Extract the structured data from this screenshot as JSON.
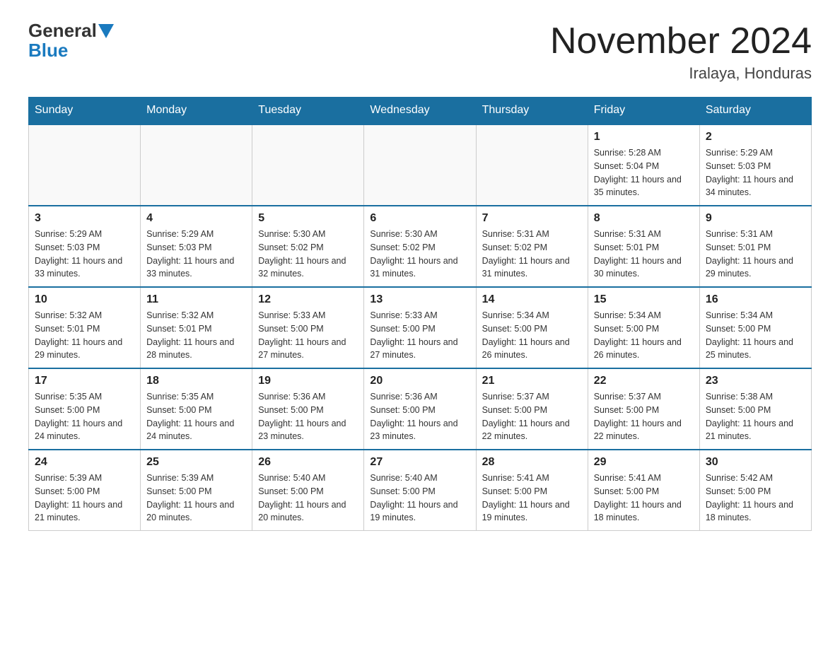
{
  "header": {
    "logo_general": "General",
    "logo_blue": "Blue",
    "month_title": "November 2024",
    "location": "Iralaya, Honduras"
  },
  "days_of_week": [
    "Sunday",
    "Monday",
    "Tuesday",
    "Wednesday",
    "Thursday",
    "Friday",
    "Saturday"
  ],
  "weeks": [
    [
      {
        "day": "",
        "info": ""
      },
      {
        "day": "",
        "info": ""
      },
      {
        "day": "",
        "info": ""
      },
      {
        "day": "",
        "info": ""
      },
      {
        "day": "",
        "info": ""
      },
      {
        "day": "1",
        "info": "Sunrise: 5:28 AM\nSunset: 5:04 PM\nDaylight: 11 hours and 35 minutes."
      },
      {
        "day": "2",
        "info": "Sunrise: 5:29 AM\nSunset: 5:03 PM\nDaylight: 11 hours and 34 minutes."
      }
    ],
    [
      {
        "day": "3",
        "info": "Sunrise: 5:29 AM\nSunset: 5:03 PM\nDaylight: 11 hours and 33 minutes."
      },
      {
        "day": "4",
        "info": "Sunrise: 5:29 AM\nSunset: 5:03 PM\nDaylight: 11 hours and 33 minutes."
      },
      {
        "day": "5",
        "info": "Sunrise: 5:30 AM\nSunset: 5:02 PM\nDaylight: 11 hours and 32 minutes."
      },
      {
        "day": "6",
        "info": "Sunrise: 5:30 AM\nSunset: 5:02 PM\nDaylight: 11 hours and 31 minutes."
      },
      {
        "day": "7",
        "info": "Sunrise: 5:31 AM\nSunset: 5:02 PM\nDaylight: 11 hours and 31 minutes."
      },
      {
        "day": "8",
        "info": "Sunrise: 5:31 AM\nSunset: 5:01 PM\nDaylight: 11 hours and 30 minutes."
      },
      {
        "day": "9",
        "info": "Sunrise: 5:31 AM\nSunset: 5:01 PM\nDaylight: 11 hours and 29 minutes."
      }
    ],
    [
      {
        "day": "10",
        "info": "Sunrise: 5:32 AM\nSunset: 5:01 PM\nDaylight: 11 hours and 29 minutes."
      },
      {
        "day": "11",
        "info": "Sunrise: 5:32 AM\nSunset: 5:01 PM\nDaylight: 11 hours and 28 minutes."
      },
      {
        "day": "12",
        "info": "Sunrise: 5:33 AM\nSunset: 5:00 PM\nDaylight: 11 hours and 27 minutes."
      },
      {
        "day": "13",
        "info": "Sunrise: 5:33 AM\nSunset: 5:00 PM\nDaylight: 11 hours and 27 minutes."
      },
      {
        "day": "14",
        "info": "Sunrise: 5:34 AM\nSunset: 5:00 PM\nDaylight: 11 hours and 26 minutes."
      },
      {
        "day": "15",
        "info": "Sunrise: 5:34 AM\nSunset: 5:00 PM\nDaylight: 11 hours and 26 minutes."
      },
      {
        "day": "16",
        "info": "Sunrise: 5:34 AM\nSunset: 5:00 PM\nDaylight: 11 hours and 25 minutes."
      }
    ],
    [
      {
        "day": "17",
        "info": "Sunrise: 5:35 AM\nSunset: 5:00 PM\nDaylight: 11 hours and 24 minutes."
      },
      {
        "day": "18",
        "info": "Sunrise: 5:35 AM\nSunset: 5:00 PM\nDaylight: 11 hours and 24 minutes."
      },
      {
        "day": "19",
        "info": "Sunrise: 5:36 AM\nSunset: 5:00 PM\nDaylight: 11 hours and 23 minutes."
      },
      {
        "day": "20",
        "info": "Sunrise: 5:36 AM\nSunset: 5:00 PM\nDaylight: 11 hours and 23 minutes."
      },
      {
        "day": "21",
        "info": "Sunrise: 5:37 AM\nSunset: 5:00 PM\nDaylight: 11 hours and 22 minutes."
      },
      {
        "day": "22",
        "info": "Sunrise: 5:37 AM\nSunset: 5:00 PM\nDaylight: 11 hours and 22 minutes."
      },
      {
        "day": "23",
        "info": "Sunrise: 5:38 AM\nSunset: 5:00 PM\nDaylight: 11 hours and 21 minutes."
      }
    ],
    [
      {
        "day": "24",
        "info": "Sunrise: 5:39 AM\nSunset: 5:00 PM\nDaylight: 11 hours and 21 minutes."
      },
      {
        "day": "25",
        "info": "Sunrise: 5:39 AM\nSunset: 5:00 PM\nDaylight: 11 hours and 20 minutes."
      },
      {
        "day": "26",
        "info": "Sunrise: 5:40 AM\nSunset: 5:00 PM\nDaylight: 11 hours and 20 minutes."
      },
      {
        "day": "27",
        "info": "Sunrise: 5:40 AM\nSunset: 5:00 PM\nDaylight: 11 hours and 19 minutes."
      },
      {
        "day": "28",
        "info": "Sunrise: 5:41 AM\nSunset: 5:00 PM\nDaylight: 11 hours and 19 minutes."
      },
      {
        "day": "29",
        "info": "Sunrise: 5:41 AM\nSunset: 5:00 PM\nDaylight: 11 hours and 18 minutes."
      },
      {
        "day": "30",
        "info": "Sunrise: 5:42 AM\nSunset: 5:00 PM\nDaylight: 11 hours and 18 minutes."
      }
    ]
  ]
}
